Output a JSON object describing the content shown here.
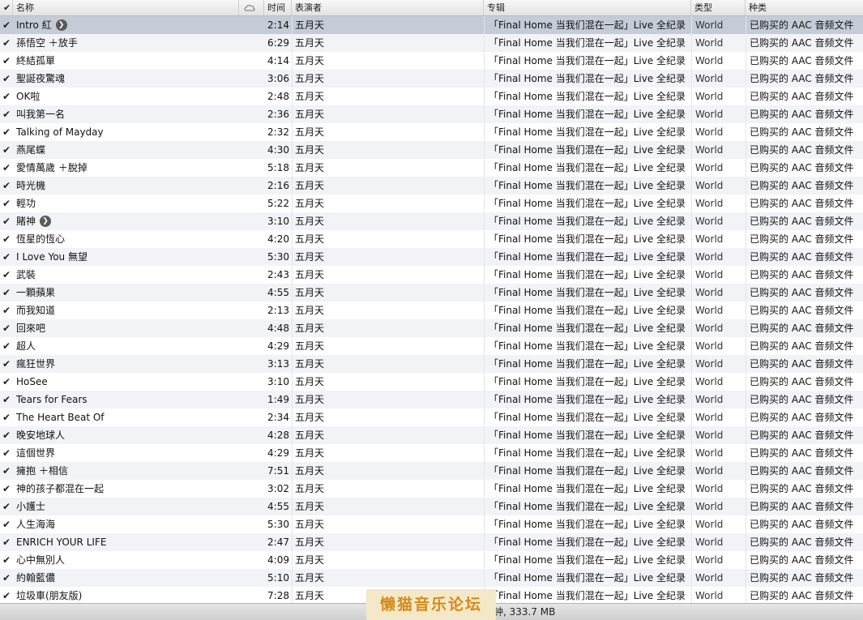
{
  "columns": {
    "name": "名称",
    "cloud_icon": "cloud-icon",
    "time": "时间",
    "artist": "表演者",
    "album": "专辑",
    "genre": "类型",
    "kind": "种类"
  },
  "check_mark": "✔",
  "tracks": [
    {
      "name": "Intro 紅",
      "time": "2:14",
      "artist": "五月天",
      "album": "「Final Home 当我们混在一起」Live 全纪录",
      "genre": "World",
      "kind": "已购买的 AAC 音频文件",
      "selected": true,
      "arrow": true
    },
    {
      "name": "孫悟空 ＋放手",
      "time": "6:29",
      "artist": "五月天",
      "album": "「Final Home 当我们混在一起」Live 全纪录",
      "genre": "World",
      "kind": "已购买的 AAC 音频文件"
    },
    {
      "name": "終結孤單",
      "time": "4:14",
      "artist": "五月天",
      "album": "「Final Home 当我们混在一起」Live 全纪录",
      "genre": "World",
      "kind": "已购买的 AAC 音频文件"
    },
    {
      "name": "聖誕夜驚魂",
      "time": "3:06",
      "artist": "五月天",
      "album": "「Final Home 当我们混在一起」Live 全纪录",
      "genre": "World",
      "kind": "已购买的 AAC 音频文件"
    },
    {
      "name": "OK啦",
      "time": "2:48",
      "artist": "五月天",
      "album": "「Final Home 当我们混在一起」Live 全纪录",
      "genre": "World",
      "kind": "已购买的 AAC 音频文件"
    },
    {
      "name": "叫我第一名",
      "time": "2:36",
      "artist": "五月天",
      "album": "「Final Home 当我们混在一起」Live 全纪录",
      "genre": "World",
      "kind": "已购买的 AAC 音频文件"
    },
    {
      "name": "Talking of Mayday",
      "time": "2:32",
      "artist": "五月天",
      "album": "「Final Home 当我们混在一起」Live 全纪录",
      "genre": "World",
      "kind": "已购买的 AAC 音频文件"
    },
    {
      "name": "燕尾蝶",
      "time": "4:30",
      "artist": "五月天",
      "album": "「Final Home 当我们混在一起」Live 全纪录",
      "genre": "World",
      "kind": "已购买的 AAC 音频文件"
    },
    {
      "name": "愛情萬歲 ＋脫掉",
      "time": "5:18",
      "artist": "五月天",
      "album": "「Final Home 当我们混在一起」Live 全纪录",
      "genre": "World",
      "kind": "已购买的 AAC 音频文件"
    },
    {
      "name": "時光機",
      "time": "2:16",
      "artist": "五月天",
      "album": "「Final Home 当我们混在一起」Live 全纪录",
      "genre": "World",
      "kind": "已购买的 AAC 音频文件"
    },
    {
      "name": "輕功",
      "time": "5:22",
      "artist": "五月天",
      "album": "「Final Home 当我们混在一起」Live 全纪录",
      "genre": "World",
      "kind": "已购买的 AAC 音频文件"
    },
    {
      "name": "賭神",
      "time": "3:10",
      "artist": "五月天",
      "album": "「Final Home 当我们混在一起」Live 全纪录",
      "genre": "World",
      "kind": "已购买的 AAC 音频文件",
      "arrow": true
    },
    {
      "name": "恆星的恆心",
      "time": "4:20",
      "artist": "五月天",
      "album": "「Final Home 当我们混在一起」Live 全纪录",
      "genre": "World",
      "kind": "已购买的 AAC 音频文件"
    },
    {
      "name": "I Love You 無望",
      "time": "5:30",
      "artist": "五月天",
      "album": "「Final Home 当我们混在一起」Live 全纪录",
      "genre": "World",
      "kind": "已购买的 AAC 音频文件"
    },
    {
      "name": "武裝",
      "time": "2:43",
      "artist": "五月天",
      "album": "「Final Home 当我们混在一起」Live 全纪录",
      "genre": "World",
      "kind": "已购买的 AAC 音频文件"
    },
    {
      "name": "一顆蘋果",
      "time": "4:55",
      "artist": "五月天",
      "album": "「Final Home 当我们混在一起」Live 全纪录",
      "genre": "World",
      "kind": "已购买的 AAC 音频文件"
    },
    {
      "name": "而我知道",
      "time": "2:13",
      "artist": "五月天",
      "album": "「Final Home 当我们混在一起」Live 全纪录",
      "genre": "World",
      "kind": "已购买的 AAC 音频文件"
    },
    {
      "name": "回來吧",
      "time": "4:48",
      "artist": "五月天",
      "album": "「Final Home 当我们混在一起」Live 全纪录",
      "genre": "World",
      "kind": "已购买的 AAC 音频文件"
    },
    {
      "name": "超人",
      "time": "4:29",
      "artist": "五月天",
      "album": "「Final Home 当我们混在一起」Live 全纪录",
      "genre": "World",
      "kind": "已购买的 AAC 音频文件"
    },
    {
      "name": "瘋狂世界",
      "time": "3:13",
      "artist": "五月天",
      "album": "「Final Home 当我们混在一起」Live 全纪录",
      "genre": "World",
      "kind": "已购买的 AAC 音频文件"
    },
    {
      "name": "HoSee",
      "time": "3:10",
      "artist": "五月天",
      "album": "「Final Home 当我们混在一起」Live 全纪录",
      "genre": "World",
      "kind": "已购买的 AAC 音频文件"
    },
    {
      "name": "Tears for Fears",
      "time": "1:49",
      "artist": "五月天",
      "album": "「Final Home 当我们混在一起」Live 全纪录",
      "genre": "World",
      "kind": "已购买的 AAC 音频文件"
    },
    {
      "name": "The Heart Beat Of",
      "time": "2:34",
      "artist": "五月天",
      "album": "「Final Home 当我们混在一起」Live 全纪录",
      "genre": "World",
      "kind": "已购买的 AAC 音频文件"
    },
    {
      "name": "晚安地球人",
      "time": "4:28",
      "artist": "五月天",
      "album": "「Final Home 当我们混在一起」Live 全纪录",
      "genre": "World",
      "kind": "已购买的 AAC 音频文件"
    },
    {
      "name": "這個世界",
      "time": "4:29",
      "artist": "五月天",
      "album": "「Final Home 当我们混在一起」Live 全纪录",
      "genre": "World",
      "kind": "已购买的 AAC 音频文件"
    },
    {
      "name": "擁抱 ＋相信",
      "time": "7:51",
      "artist": "五月天",
      "album": "「Final Home 当我们混在一起」Live 全纪录",
      "genre": "World",
      "kind": "已购买的 AAC 音频文件"
    },
    {
      "name": "神的孩子都混在一起",
      "time": "3:02",
      "artist": "五月天",
      "album": "「Final Home 当我们混在一起」Live 全纪录",
      "genre": "World",
      "kind": "已购买的 AAC 音频文件"
    },
    {
      "name": "小護士",
      "time": "4:55",
      "artist": "五月天",
      "album": "「Final Home 当我们混在一起」Live 全纪录",
      "genre": "World",
      "kind": "已购买的 AAC 音频文件"
    },
    {
      "name": "人生海海",
      "time": "5:30",
      "artist": "五月天",
      "album": "「Final Home 当我们混在一起」Live 全纪录",
      "genre": "World",
      "kind": "已购买的 AAC 音频文件"
    },
    {
      "name": "ENRICH YOUR LIFE",
      "time": "2:47",
      "artist": "五月天",
      "album": "「Final Home 当我们混在一起」Live 全纪录",
      "genre": "World",
      "kind": "已购买的 AAC 音频文件"
    },
    {
      "name": "心中無別人",
      "time": "4:09",
      "artist": "五月天",
      "album": "「Final Home 当我们混在一起」Live 全纪录",
      "genre": "World",
      "kind": "已购买的 AAC 音频文件"
    },
    {
      "name": "約翰藍儂",
      "time": "5:10",
      "artist": "五月天",
      "album": "「Final Home 当我们混在一起」Live 全纪录",
      "genre": "World",
      "kind": "已购买的 AAC 音频文件"
    },
    {
      "name": "垃圾車(朋友版)",
      "time": "7:28",
      "artist": "五月天",
      "album": "「Final Home 当我们混在一起」Live 全纪录",
      "genre": "World",
      "kind": "已购买的 AAC 音频文件"
    }
  ],
  "status_bar": {
    "text": "钟, 333.7 MB"
  },
  "watermark": "懒猫音乐论坛",
  "colors": {
    "selected_row": "#c5ccd8",
    "alt_row": "#f1f3f7",
    "arrow_button": "#5a5a5a",
    "watermark_text": "#d58a1c"
  }
}
